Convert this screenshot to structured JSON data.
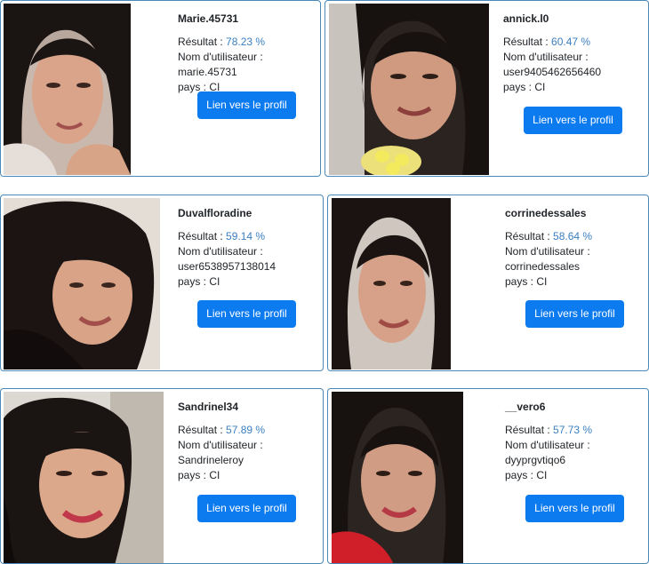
{
  "labels": {
    "score": "Résultat : ",
    "username": "Nom d'utilisateur : ",
    "country": "pays : ",
    "profile_link": "Lien vers le profil"
  },
  "results": [
    {
      "name": "Marie.45731",
      "score": "78.23 %",
      "username": "marie.45731",
      "country": "CI"
    },
    {
      "name": "annick.l0",
      "score": "60.47 %",
      "username": "user9405462656460",
      "country": "CI"
    },
    {
      "name": "Duvalfloradine",
      "score": "59.14 %",
      "username": "user6538957138014",
      "country": "CI"
    },
    {
      "name": "corrinedessales",
      "score": "58.64 %",
      "username": "corrinedessales",
      "country": "CI"
    },
    {
      "name": "Sandrinel34",
      "score": "57.89 %",
      "username": "Sandrineleroy",
      "country": "CI"
    },
    {
      "name": "__vero6",
      "score": "57.73 %",
      "username": "dyyprgvtiqo6",
      "country": "CI"
    }
  ],
  "colors": {
    "accent": "#0d7bf0",
    "percent": "#3a7fc1",
    "card_border": "#4a89b8"
  }
}
